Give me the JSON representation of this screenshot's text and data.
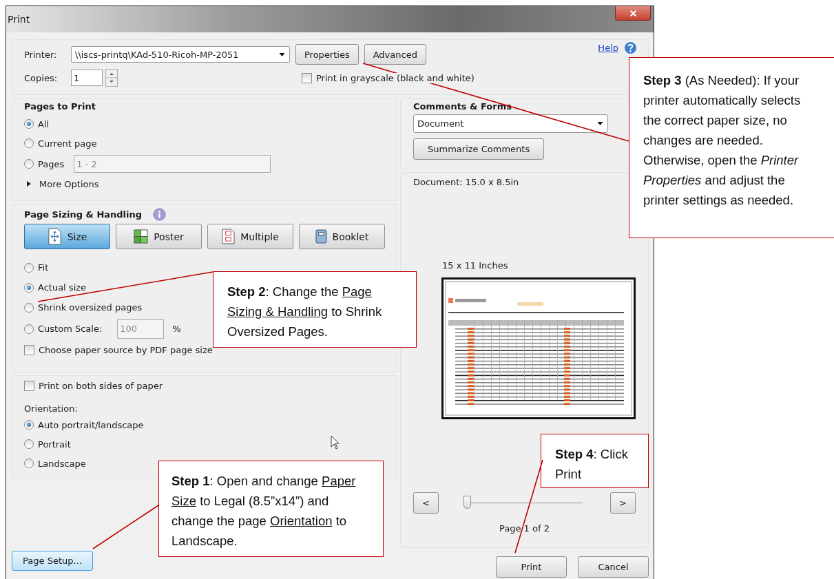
{
  "window": {
    "title": "Print"
  },
  "printer": {
    "label": "Printer:",
    "value": "\\\\iscs-printq\\KAd-510-Ricoh-MP-2051"
  },
  "top_buttons": [
    "Properties",
    "Advanced"
  ],
  "help": "Help",
  "copies": {
    "label": "Copies:",
    "value": "1"
  },
  "grayscale": {
    "label": "Print in grayscale (black and white)",
    "checked": false
  },
  "pages_to_print": {
    "title": "Pages to Print",
    "options": [
      {
        "label": "All",
        "selected": true
      },
      {
        "label": "Current page",
        "selected": false
      },
      {
        "label": "Pages",
        "selected": false,
        "value": "1 - 2"
      }
    ],
    "more_options": "More Options"
  },
  "page_sizing": {
    "title": "Page Sizing & Handling",
    "modes": [
      {
        "label": "Size",
        "selected": true,
        "kind": "size"
      },
      {
        "label": "Poster",
        "selected": false,
        "kind": "poster"
      },
      {
        "label": "Multiple",
        "selected": false,
        "kind": "multiple"
      },
      {
        "label": "Booklet",
        "selected": false,
        "kind": "booklet"
      }
    ],
    "options": [
      {
        "label": "Fit",
        "selected": false
      },
      {
        "label": "Actual size",
        "selected": true
      },
      {
        "label": "Shrink oversized pages",
        "selected": false
      },
      {
        "label": "Custom Scale:",
        "selected": false,
        "value": "100",
        "unit": "%"
      }
    ],
    "paper_source": {
      "label": "Choose paper source by PDF page size",
      "checked": false
    }
  },
  "duplex": {
    "label": "Print on both sides of paper",
    "checked": false
  },
  "orientation": {
    "title": "Orientation:",
    "options": [
      {
        "label": "Auto portrait/landscape",
        "selected": true
      },
      {
        "label": "Portrait",
        "selected": false
      },
      {
        "label": "Landscape",
        "selected": false
      }
    ]
  },
  "comments_forms": {
    "title": "Comments & Forms",
    "value": "Document",
    "button": "Summarize Comments"
  },
  "preview": {
    "document_size": "Document: 15.0 x 8.5in",
    "sheet_size": "15 x 11 Inches",
    "prev": "<",
    "next": ">",
    "level": 0,
    "page_label": "Page 1 of 2"
  },
  "page_setup": "Page Setup...",
  "actions": [
    "Print",
    "Cancel"
  ],
  "callouts": [
    {
      "segments": [
        {
          "text": "Step 3",
          "kind": "bold"
        },
        {
          "text": " (As Needed): If your printer automatically selects the correct paper size, no changes are needed. Otherwise, open the ",
          "kind": "plain"
        },
        {
          "text": "Printer Properties",
          "kind": "italic"
        },
        {
          "text": " and adjust the printer settings as needed.",
          "kind": "plain"
        }
      ]
    },
    {
      "segments": [
        {
          "text": "Step 2",
          "kind": "bold"
        },
        {
          "text": ": Change the ",
          "kind": "plain"
        },
        {
          "text": "Page Sizing & Handling",
          "kind": "underline"
        },
        {
          "text": " to Shrink Oversized Pages.",
          "kind": "plain"
        }
      ]
    },
    {
      "segments": [
        {
          "text": "Step 4",
          "kind": "bold"
        },
        {
          "text": ": Click Print",
          "kind": "plain"
        }
      ]
    },
    {
      "segments": [
        {
          "text": "Step 1",
          "kind": "bold"
        },
        {
          "text": ": Open and change ",
          "kind": "plain"
        },
        {
          "text": "Paper Size",
          "kind": "underline"
        },
        {
          "text": " to Legal (8.5”x14”) and change the page ",
          "kind": "plain"
        },
        {
          "text": "Orientation",
          "kind": "underline"
        },
        {
          "text": " to Landscape.",
          "kind": "plain"
        }
      ]
    }
  ]
}
